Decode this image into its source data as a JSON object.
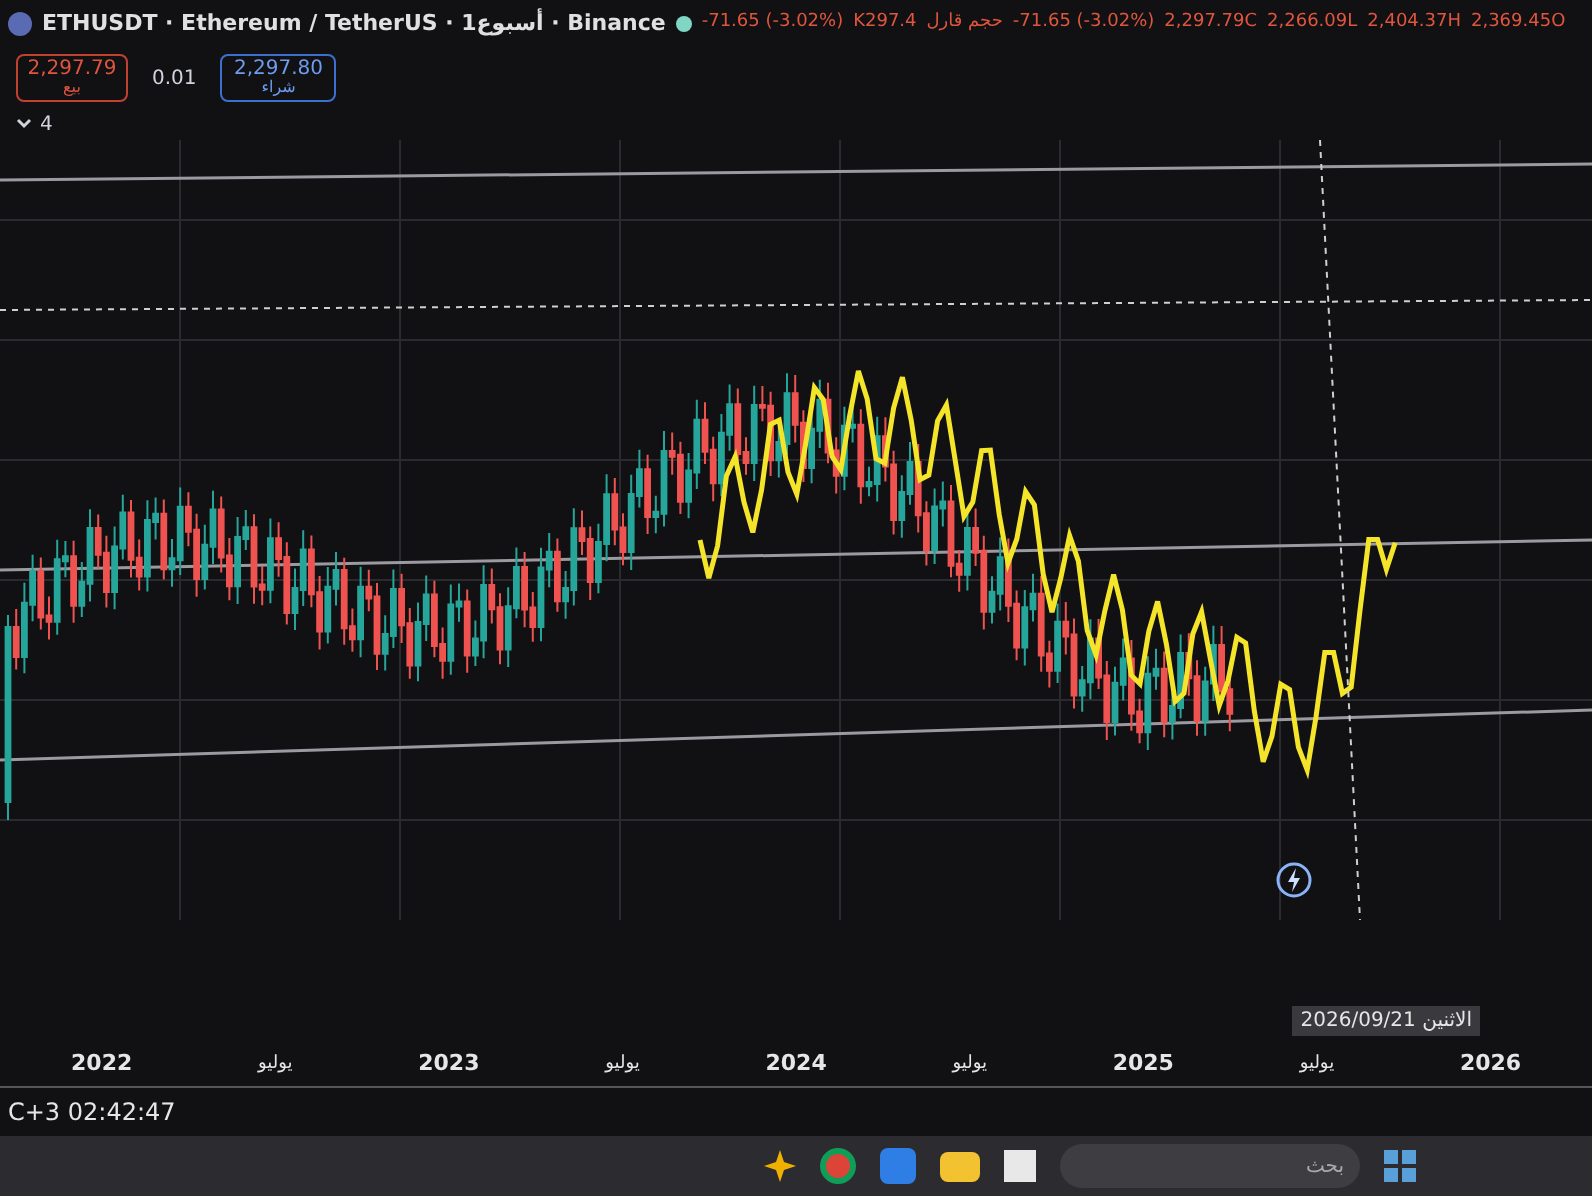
{
  "legend": {
    "title": "ETHUSDT · Ethereum / TetherUS · 1أسبوع · Binance",
    "stats": [
      {
        "kind": "ohlc",
        "text": "2,369.45",
        "letter": "O"
      },
      {
        "kind": "ohlc",
        "text": "2,404.37",
        "letter": "H"
      },
      {
        "kind": "ohlc",
        "text": "2,266.09",
        "letter": "L"
      },
      {
        "kind": "ohlc",
        "text": "2,297.79",
        "letter": "C"
      },
      {
        "kind": "change",
        "text": "-71.65 (-3.02%)"
      },
      {
        "kind": "volume",
        "text": "K297.4",
        "label": "حجم قارل"
      },
      {
        "kind": "change",
        "text": "-71.65 (-3.02%)"
      }
    ]
  },
  "trade": {
    "sell": {
      "price": "2,297.79",
      "label": "بيع"
    },
    "spread": "0.01",
    "buy": {
      "price": "2,297.80",
      "label": "شراء"
    }
  },
  "indicators": {
    "count": "4",
    "expanded": false
  },
  "x_axis": [
    {
      "year": "2026"
    },
    {
      "month": "يوليو",
      "year": "2025"
    },
    {
      "month": "يوليو",
      "year": "2024"
    },
    {
      "month": "يوليو",
      "year": "2023"
    },
    {
      "month": "يوليو",
      "year": "2022"
    }
  ],
  "crosshair_label": "الاثنين 2026/09/21",
  "status": {
    "time": "C+3 02:42:47"
  },
  "taskbar": {
    "search_placeholder": "بحث"
  }
}
